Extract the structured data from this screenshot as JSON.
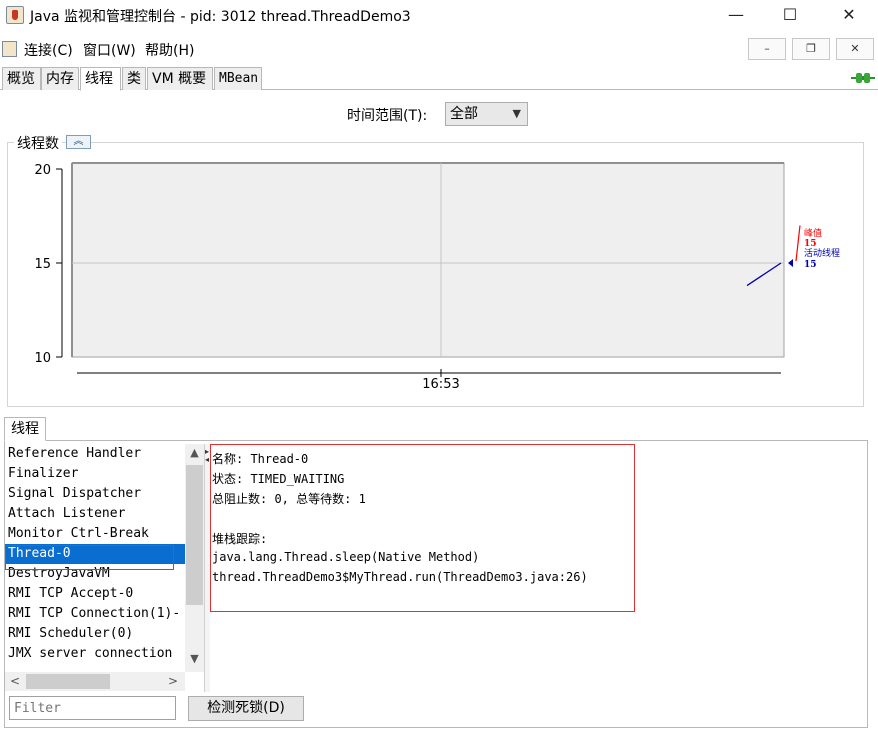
{
  "window": {
    "title": "Java 监视和管理控制台 - pid: 3012 thread.ThreadDemo3",
    "minimize": "—",
    "maximize": "☐",
    "close": "✕"
  },
  "menu": {
    "items": [
      "连接(C)",
      "窗口(W)",
      "帮助(H)"
    ],
    "mdi_minimize": "–",
    "mdi_restore": "❐",
    "mdi_close": "✕"
  },
  "tabs": [
    "概览",
    "内存",
    "线程",
    "类",
    "VM 概要",
    "MBean"
  ],
  "active_tab": "线程",
  "time_range": {
    "label": "时间范围(T):",
    "value": "全部"
  },
  "chart_panel": {
    "title": "线程数",
    "collapse_icon": "chevron-double-up-icon"
  },
  "chart_data": {
    "type": "line",
    "ylim": [
      10,
      20
    ],
    "yticks": [
      "20",
      "15",
      "10"
    ],
    "xticks": [
      "16:53"
    ],
    "grid": true,
    "series": [
      {
        "name": "峰值",
        "color": "#ff0000",
        "latest": "15"
      },
      {
        "name": "活动线程",
        "color": "#0000b0",
        "latest": "15",
        "values": [
          13.8,
          15
        ]
      }
    ]
  },
  "threads_panel": {
    "tab_label": "线程",
    "threads": [
      "Reference Handler",
      "Finalizer",
      "Signal Dispatcher",
      "Attach Listener",
      "Monitor Ctrl-Break",
      "Thread-0",
      "DestroyJavaVM",
      "RMI TCP Accept-0",
      "RMI TCP Connection(1)-",
      "RMI Scheduler(0)",
      "JMX server connection"
    ],
    "selected_index": 5,
    "detail": {
      "name_line": "名称: Thread-0",
      "state_line": "状态: TIMED_WAITING",
      "counts_line": "总阻止数: 0, 总等待数: 1",
      "stack_header": "堆栈跟踪:",
      "stack": [
        "java.lang.Thread.sleep(Native Method)",
        "thread.ThreadDemo3$MyThread.run(ThreadDemo3.java:26)"
      ]
    },
    "filter_placeholder": "Filter",
    "deadlock_button": "检测死锁(D)"
  }
}
